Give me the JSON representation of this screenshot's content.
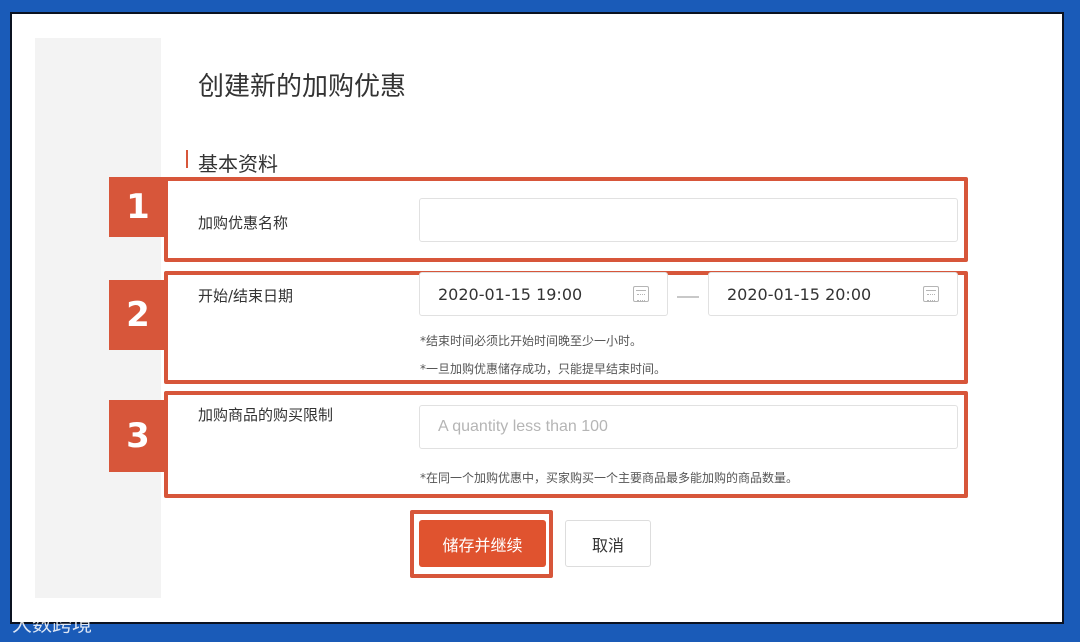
{
  "page": {
    "title": "创建新的加购优惠",
    "section_title": "基本资料"
  },
  "steps": [
    "1",
    "2",
    "3"
  ],
  "fields": {
    "name_label": "加购优惠名称",
    "name_value": "",
    "date_label": "开始/结束日期",
    "start_date": "2020-01-15 19:00",
    "end_date": "2020-01-15 20:00",
    "date_hint_1": "*结束时间必须比开始时间晚至少一小时。",
    "date_hint_2": "*一旦加购优惠储存成功，只能提早结束时间。",
    "limit_label": "加购商品的购买限制",
    "limit_placeholder": "A quantity less than 100",
    "limit_hint": "*在同一个加购优惠中，买家购买一个主要商品最多能加购的商品数量。"
  },
  "actions": {
    "save_label": "储存并继续",
    "cancel_label": "取消"
  },
  "watermark": "大数跨境",
  "colors": {
    "accent": "#d7563a",
    "border": "#1a5bb8"
  }
}
